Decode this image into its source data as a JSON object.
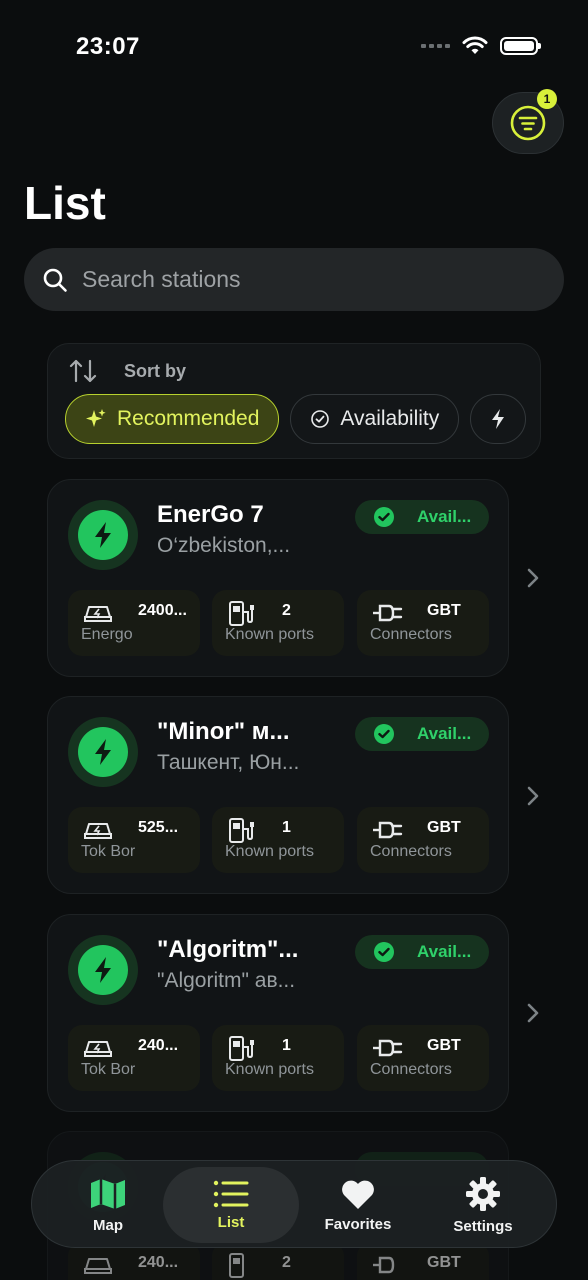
{
  "status_bar": {
    "time": "23:07"
  },
  "header": {
    "title": "List",
    "filter_badge": "1"
  },
  "search": {
    "placeholder": "Search stations"
  },
  "sort": {
    "label": "Sort by",
    "options": [
      "Recommended",
      "Availability"
    ],
    "selected": "Recommended"
  },
  "stations": [
    {
      "name": "EnerGo 7",
      "address": "O‘zbekiston,...",
      "status": "Avail...",
      "provider_value": "2400...",
      "provider": "Energo",
      "ports_value": "2",
      "ports_label": "Known ports",
      "connector_value": "GBT",
      "connector_label": "Connectors"
    },
    {
      "name": "\"Minor\" м...",
      "address": "Ташкент, Юн...",
      "status": "Avail...",
      "provider_value": "525...",
      "provider": "Tok Bor",
      "ports_value": "1",
      "ports_label": "Known ports",
      "connector_value": "GBT",
      "connector_label": "Connectors"
    },
    {
      "name": "\"Algoritm\"...",
      "address": "\"Algoritm\" ав...",
      "status": "Avail...",
      "provider_value": "240...",
      "provider": "Tok Bor",
      "ports_value": "1",
      "ports_label": "Known ports",
      "connector_value": "GBT",
      "connector_label": "Connectors"
    },
    {
      "provider_value": "240...",
      "ports_value": "2",
      "connector_value": "GBT"
    }
  ],
  "nav": {
    "items": [
      {
        "label": "Map",
        "icon": "map-icon"
      },
      {
        "label": "List",
        "icon": "list-icon"
      },
      {
        "label": "Favorites",
        "icon": "heart-icon"
      },
      {
        "label": "Settings",
        "icon": "gear-icon"
      }
    ],
    "active": "List"
  },
  "colors": {
    "accent": "#d8f03a",
    "available_green": "#22c55e",
    "background": "#0b0d0e"
  }
}
